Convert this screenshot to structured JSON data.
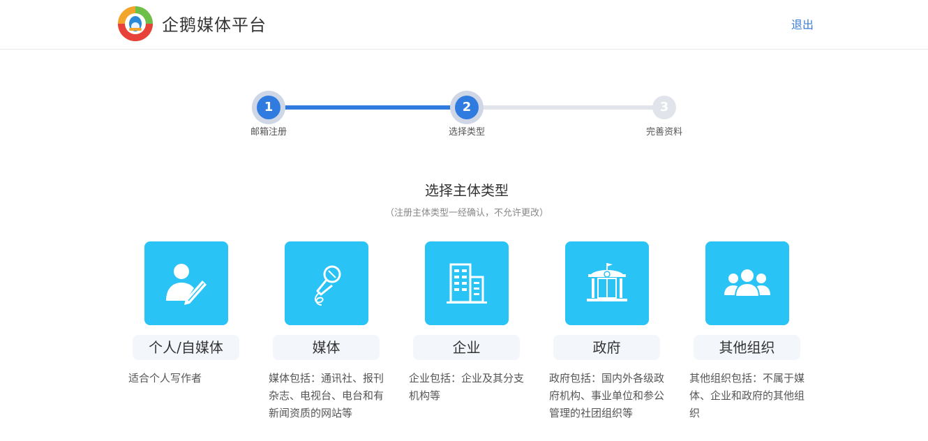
{
  "header": {
    "brand": "企鹅媒体平台",
    "logout_label": "退出"
  },
  "steps": [
    {
      "number": "1",
      "label": "邮箱注册",
      "state": "done"
    },
    {
      "number": "2",
      "label": "选择类型",
      "state": "current"
    },
    {
      "number": "3",
      "label": "完善资料",
      "state": "todo"
    }
  ],
  "progress_fraction": 0.5,
  "section": {
    "title": "选择主体类型",
    "subtitle": "（注册主体类型一经确认，不允许更改）"
  },
  "cards": [
    {
      "name": "个人/自媒体",
      "desc": "适合个人写作者",
      "icon": "person-pen-icon"
    },
    {
      "name": "媒体",
      "desc": "媒体包括：通讯社、报刊杂志、电视台、电台和有新闻资质的网站等",
      "icon": "microphone-icon"
    },
    {
      "name": "企业",
      "desc": "企业包括：企业及其分支机构等",
      "icon": "office-building-icon"
    },
    {
      "name": "政府",
      "desc": "政府包括：国内外各级政府机构、事业单位和参公管理的社团组织等",
      "icon": "government-building-icon"
    },
    {
      "name": "其他组织",
      "desc": "其他组织包括：不属于媒体、企业和政府的其他组织",
      "icon": "group-people-icon"
    }
  ],
  "colors": {
    "accent": "#2f7be0",
    "tile": "#29c3f5",
    "link": "#3a7bd5"
  }
}
